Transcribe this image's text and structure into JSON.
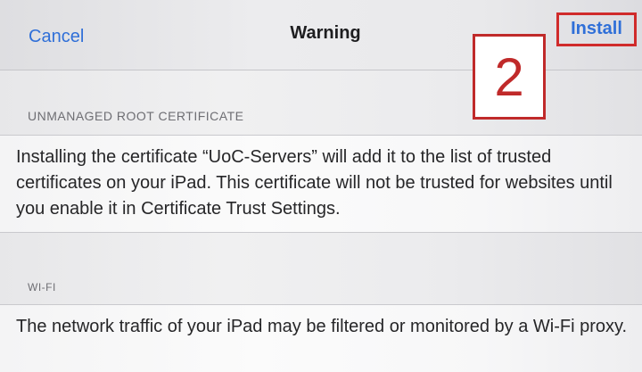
{
  "nav": {
    "cancel_label": "Cancel",
    "title": "Warning",
    "install_label": "Install"
  },
  "annotation": {
    "step_number": "2"
  },
  "sections": {
    "certificate": {
      "header": "UNMANAGED ROOT CERTIFICATE",
      "body": "Installing the certificate “UoC-Servers” will add it to the list of trusted certificates on your iPad. This certificate will not be trusted for websites until you enable it in Certificate Trust Settings."
    },
    "wifi": {
      "header": "WI-FI",
      "body": "The network traffic of your iPad may be filtered or monitored by a Wi-Fi proxy."
    }
  },
  "colors": {
    "accent": "#2f6fd8",
    "annotation_red": "#c02a2a"
  }
}
